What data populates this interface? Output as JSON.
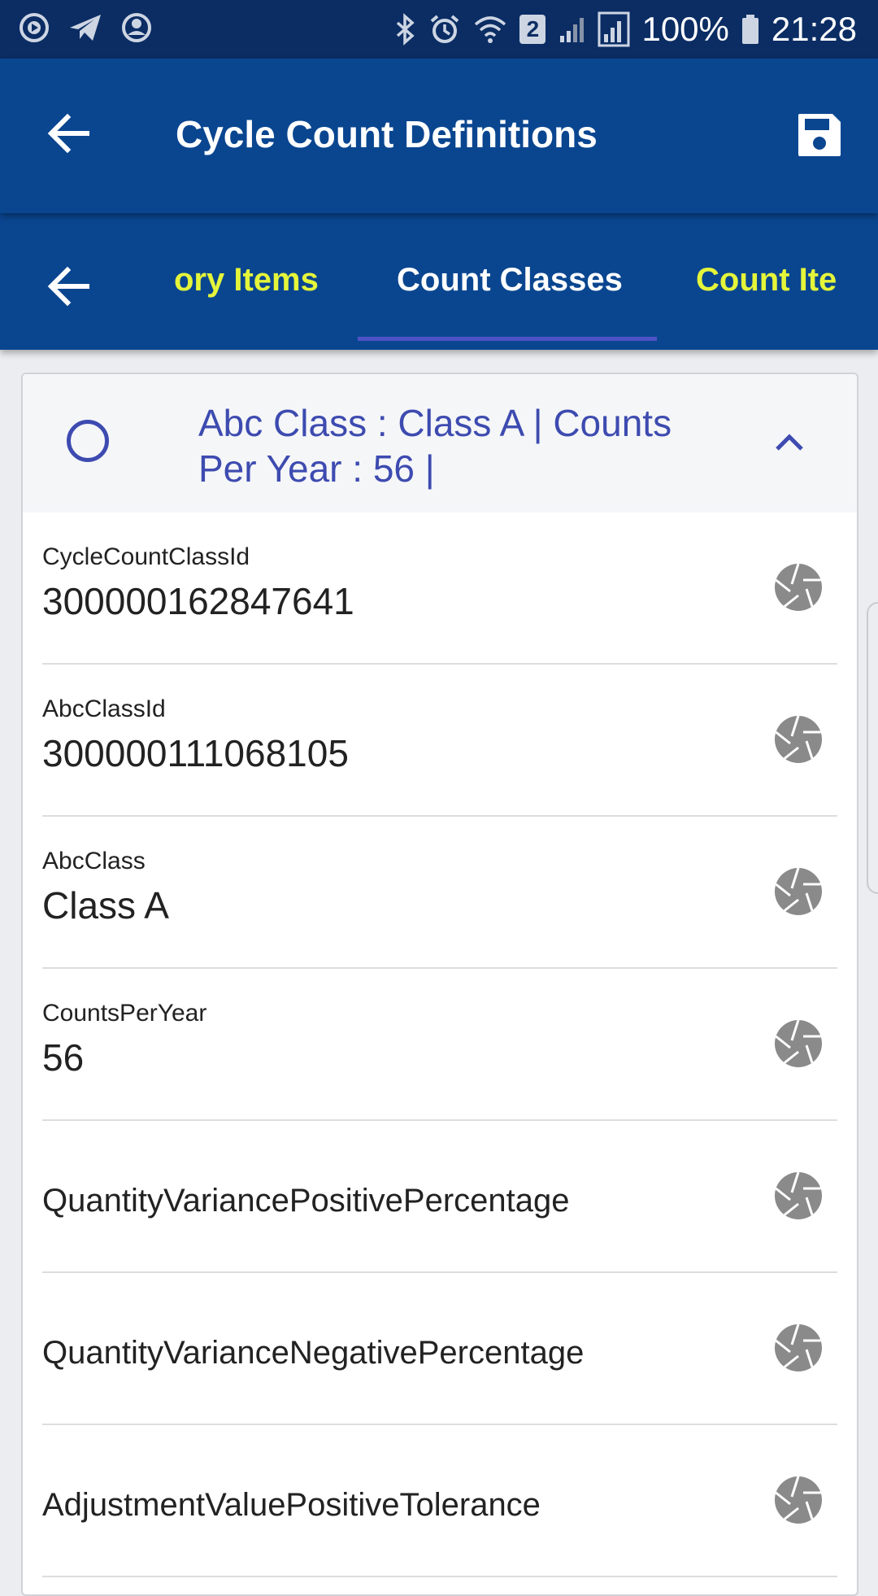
{
  "status_bar": {
    "battery": "100%",
    "time": "21:28",
    "sim_badge": "2"
  },
  "app_bar": {
    "title": "Cycle Count Definitions"
  },
  "tabs": [
    {
      "label": "ory Items",
      "active": false
    },
    {
      "label": "Count Classes",
      "active": true
    },
    {
      "label": "Count Ite",
      "active": false
    }
  ],
  "card": {
    "header_text": "Abc Class : Class A | Counts Per Year : 56 |",
    "fields": [
      {
        "label": "CycleCountClassId",
        "value": "300000162847641"
      },
      {
        "label": "AbcClassId",
        "value": "300000111068105"
      },
      {
        "label": "AbcClass",
        "value": "Class A"
      },
      {
        "label": "CountsPerYear",
        "value": "56"
      },
      {
        "label": "QuantityVariancePositivePercentage",
        "value": ""
      },
      {
        "label": "QuantityVarianceNegativePercentage",
        "value": ""
      },
      {
        "label": "AdjustmentValuePositiveTolerance",
        "value": ""
      }
    ]
  },
  "colors": {
    "status_bar": "#0b2d64",
    "app_bar": "#0a4690",
    "active_tab": "#ffffff",
    "inactive_tab": "#e4f53a",
    "indicator": "#4f52c6",
    "header_text": "#3d4bb0",
    "row_icon": "#8a8a8a"
  },
  "icons": {
    "status_left": [
      "play-circle-icon",
      "send-icon",
      "account-circle-icon"
    ],
    "status_right": [
      "bluetooth-icon",
      "alarm-icon",
      "wifi-icon",
      "sim-badge-icon",
      "signal-icon",
      "signal-icon",
      "battery-icon"
    ],
    "app_bar": [
      "arrow-back-icon",
      "save-icon"
    ],
    "row": "camera-aperture-icon"
  }
}
